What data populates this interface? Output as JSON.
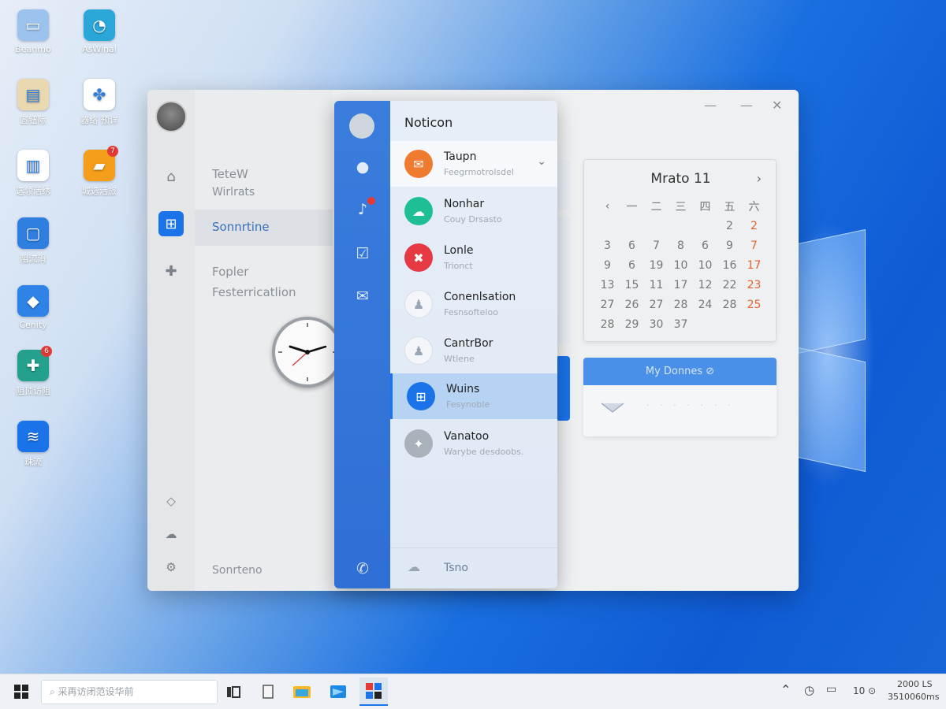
{
  "desktop": {
    "icons": [
      {
        "label": "Beanmo",
        "icon": "laptop-icon",
        "color": "#9cc3ee"
      },
      {
        "label": "AsWinal",
        "icon": "edge-icon",
        "color": "#2aa6d9"
      },
      {
        "label": "圆钮际",
        "icon": "document-icon",
        "color": "#e9d8b0"
      },
      {
        "label": "器络 预详",
        "icon": "pinwheel-icon",
        "color": "#ffffff"
      },
      {
        "label": "选领活绣",
        "icon": "chart-icon",
        "color": "#ffffff"
      },
      {
        "label": "城选活旅",
        "icon": "app-icon",
        "color": "#f59e1b",
        "badge": "7"
      },
      {
        "label": "阻流消",
        "icon": "message-icon",
        "color": "#2f7fe0"
      },
      {
        "label": "Cenity",
        "icon": "eraser-icon",
        "color": "#2f82e6"
      },
      {
        "label": "阻顶访阻",
        "icon": "plus-icon",
        "color": "#23a08e",
        "badge": "6"
      },
      {
        "label": "珠流",
        "icon": "wifi-icon",
        "color": "#1a73e8"
      }
    ]
  },
  "window": {
    "nav": {
      "items": [
        "TeteW",
        "Wirlrats",
        "Sonnrtine",
        "Fopler",
        "Festerricatlion"
      ],
      "bottom": "Sonrteno"
    },
    "controls": {
      "minimize": "—",
      "restore": "—",
      "close": "✕"
    },
    "calendar": {
      "title": "Mrato 11",
      "next": "›",
      "weekdays": [
        "‹",
        "一",
        "二",
        "三",
        "四",
        "五",
        "六"
      ],
      "rows": [
        [
          "",
          "",
          "",
          "",
          "",
          "2",
          "2"
        ],
        [
          "3",
          "6",
          "7",
          "8",
          "6",
          "9",
          "7"
        ],
        [
          "9",
          "6",
          "19",
          "10",
          "10",
          "16",
          "17"
        ],
        [
          "13",
          "15",
          "11",
          "17",
          "12",
          "22",
          "23"
        ],
        [
          "27",
          "26",
          "27",
          "28",
          "24",
          "28",
          "25"
        ],
        [
          "28",
          "29",
          "30",
          "37",
          "",
          "",
          ""
        ]
      ]
    },
    "mycard": {
      "title": "My Donnes ⊘",
      "minis": [
        "·",
        "·",
        "·",
        "·",
        "·",
        "·",
        "·"
      ]
    }
  },
  "notification": {
    "title": "Noticon",
    "items": [
      {
        "title": "Taupn",
        "sub": "Feegrmotrolsdel",
        "color": "#f07a2e",
        "glyph": "✉"
      },
      {
        "title": "Nonhar",
        "sub": "Couy Drsasto",
        "color": "#1fbf95",
        "glyph": "☁"
      },
      {
        "title": "Lonle",
        "sub": "Trionct",
        "color": "#e53944",
        "glyph": "✖"
      },
      {
        "title": "Conenlsation",
        "sub": "Fesnsofteloo",
        "color": "#f3f5f8",
        "glyph": "♟"
      },
      {
        "title": "CantrBor",
        "sub": "Wtlene",
        "color": "#f3f5f8",
        "glyph": "♟"
      },
      {
        "title": "Wuins",
        "sub": "Fesynoble",
        "color": "#1a73e8",
        "glyph": "⊞"
      },
      {
        "title": "Vanatoo",
        "sub": "Warybe desdoobs.",
        "color": "#a9b1bb",
        "glyph": "✦"
      }
    ],
    "footer": "Tsno"
  },
  "taskbar": {
    "search_placeholder": "⌕ 采再访闭范设华前",
    "tray": {
      "vol": "10 ⊙",
      "time": "2000 LS",
      "date": "3510060ms"
    }
  }
}
